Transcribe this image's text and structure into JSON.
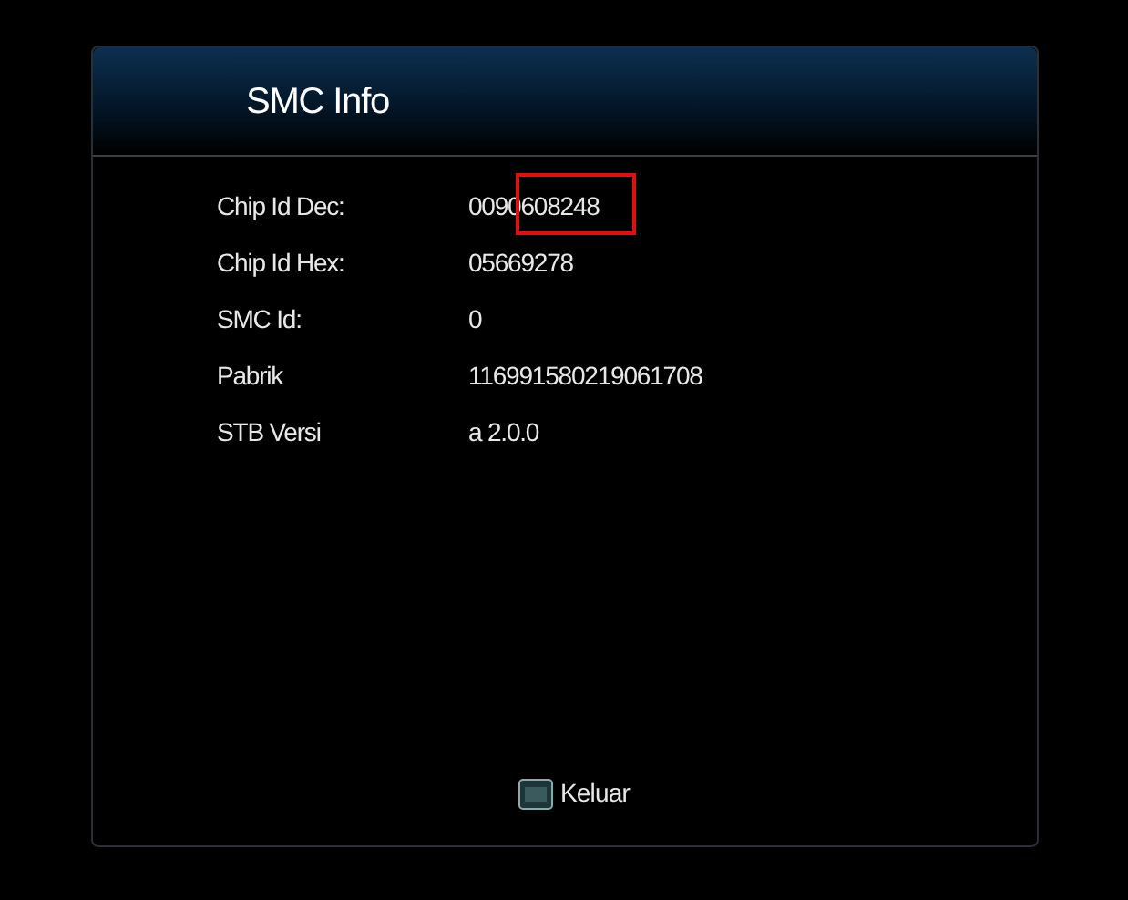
{
  "window": {
    "title": "SMC Info"
  },
  "rows": [
    {
      "label": "Chip Id Dec:",
      "value": "0090608248",
      "highlighted": true
    },
    {
      "label": "Chip Id Hex:",
      "value": "05669278",
      "highlighted": false
    },
    {
      "label": "SMC Id:",
      "value": "0",
      "highlighted": false
    },
    {
      "label": "Pabrik",
      "value": "116991580219061708",
      "highlighted": false
    },
    {
      "label": "STB Versi",
      "value": "a 2.0.0",
      "highlighted": false
    }
  ],
  "footer": {
    "label": "Keluar"
  }
}
